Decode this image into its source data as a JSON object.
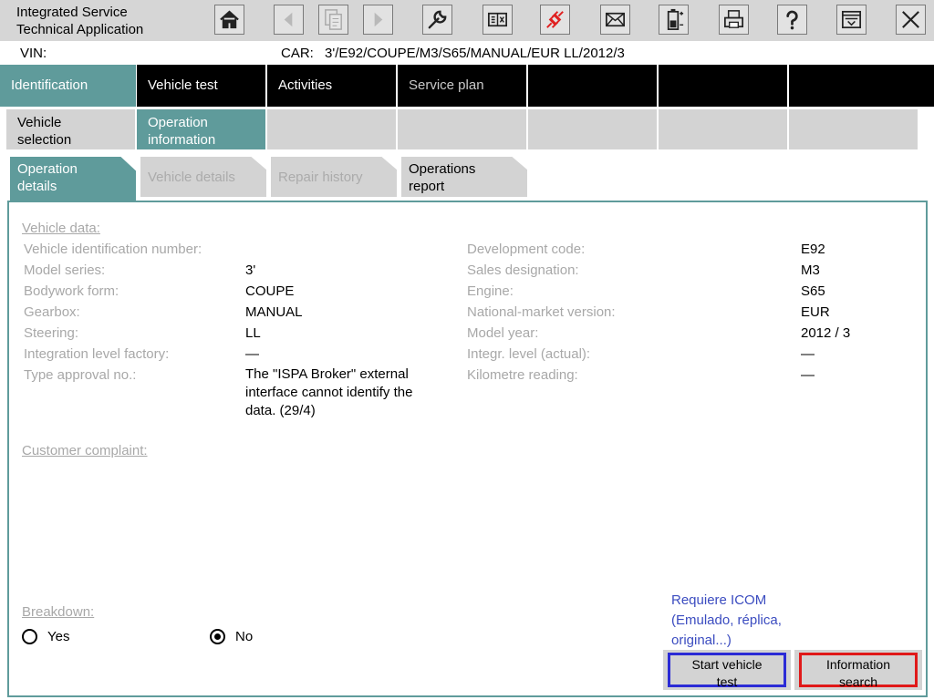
{
  "app": {
    "title_line1": "Integrated Service",
    "title_line2": "Technical Application"
  },
  "toolbar": {
    "icons": [
      "home-icon",
      "back-icon",
      "copy-icon",
      "forward-icon",
      "wrench-icon",
      "compare-icon",
      "connection-icon",
      "mail-icon",
      "battery-icon",
      "print-icon",
      "help-icon",
      "dropdown-panel-icon",
      "close-icon"
    ],
    "accent_color": "#e02020"
  },
  "vin": {
    "label": "VIN:",
    "car_label": "CAR:",
    "car_value": "3'/E92/COUPE/M3/S65/MANUAL/EUR LL/2012/3"
  },
  "main_tabs": [
    "Identification",
    "Vehicle test",
    "Activities",
    "Service plan",
    "",
    "",
    ""
  ],
  "sub_tabs": [
    {
      "line1": "Vehicle",
      "line2": "selection"
    },
    {
      "line1": "Operation",
      "line2": "information"
    }
  ],
  "detail_tabs": [
    {
      "line1": "Operation",
      "line2": "details"
    },
    {
      "line1": "Vehicle details",
      "line2": ""
    },
    {
      "line1": "Repair history",
      "line2": ""
    },
    {
      "line1": "Operations",
      "line2": "report"
    }
  ],
  "vehicle_data": {
    "title": "Vehicle data:",
    "left": [
      {
        "label": "Vehicle identification number:",
        "value": ""
      },
      {
        "label": "Model series:",
        "value": "3'"
      },
      {
        "label": "Bodywork form:",
        "value": "COUPE"
      },
      {
        "label": "Gearbox:",
        "value": "MANUAL"
      },
      {
        "label": "Steering:",
        "value": "LL"
      },
      {
        "label": "Integration level factory:",
        "value": "—"
      },
      {
        "label": "Type approval no.:",
        "value": ""
      }
    ],
    "type_approval_lines": [
      "The \"ISPA Broker\" external",
      "interface cannot identify the",
      "data. (29/4)"
    ],
    "right": [
      {
        "label": "Development code:",
        "value": "E92"
      },
      {
        "label": "Sales designation:",
        "value": "M3"
      },
      {
        "label": "Engine:",
        "value": "S65"
      },
      {
        "label": "National-market version:",
        "value": "EUR"
      },
      {
        "label": "Model year:",
        "value": "2012 / 3"
      },
      {
        "label": "Integr. level (actual):",
        "value": "—"
      },
      {
        "label": "Kilometre reading:",
        "value": "—"
      }
    ]
  },
  "customer_complaint": {
    "title": "Customer complaint:"
  },
  "breakdown": {
    "title": "Breakdown:",
    "yes_label": "Yes",
    "no_label": "No",
    "selected": "No"
  },
  "note": {
    "line1": "Requiere ICOM",
    "line2": "(Emulado, réplica,",
    "line3": "original...)",
    "color": "#3b4cc0"
  },
  "buttons": {
    "start_line1": "Start vehicle",
    "start_line2": "test",
    "start_highlight": "#2b2bd6",
    "info_line1": "Information",
    "info_line2": "search",
    "info_highlight": "#e01818"
  }
}
